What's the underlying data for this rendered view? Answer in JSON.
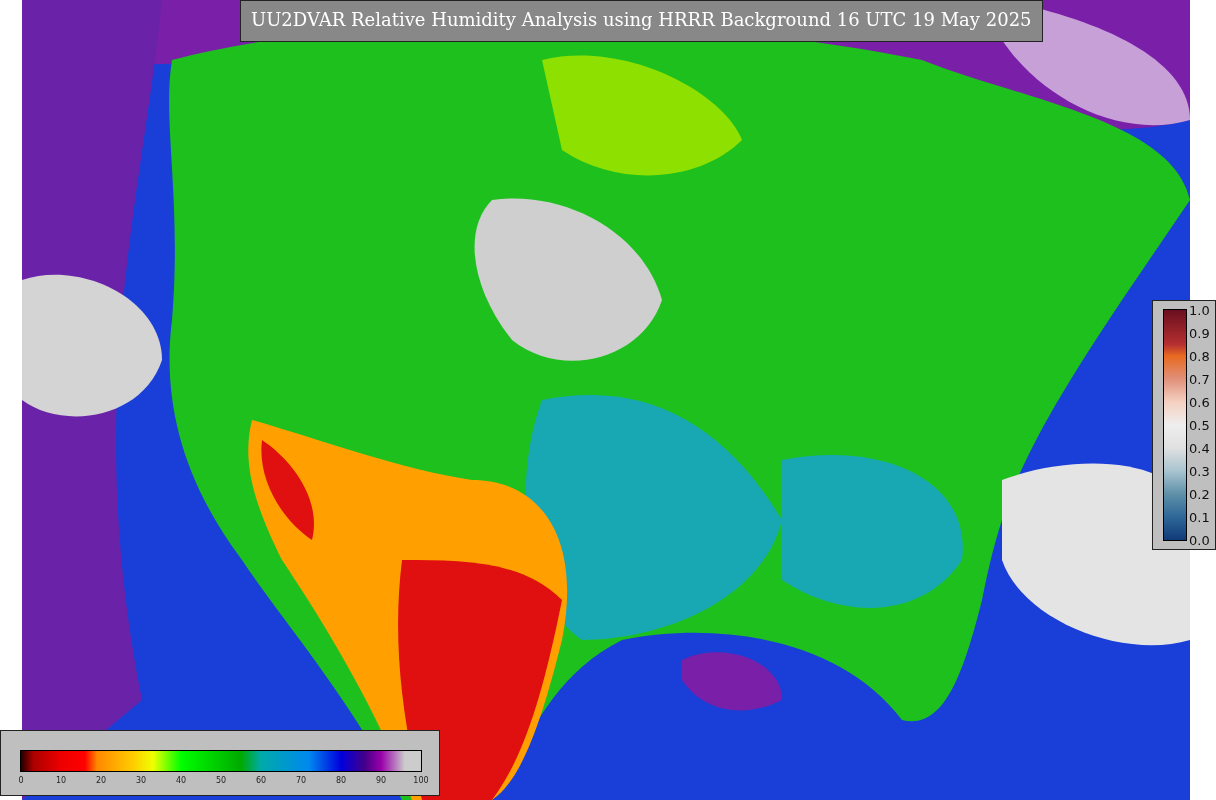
{
  "title": "UU2DVAR Relative Humidity Analysis using HRRR Background 16 UTC 19 May 2025",
  "humidity_colorbar": {
    "ticks": [
      "0",
      "10",
      "20",
      "30",
      "40",
      "50",
      "60",
      "70",
      "80",
      "90",
      "100"
    ]
  },
  "station_colorbar": {
    "ticks": [
      "1.0",
      "0.9",
      "0.8",
      "0.7",
      "0.6",
      "0.5",
      "0.4",
      "0.3",
      "0.2",
      "0.1",
      "0.0"
    ]
  }
}
